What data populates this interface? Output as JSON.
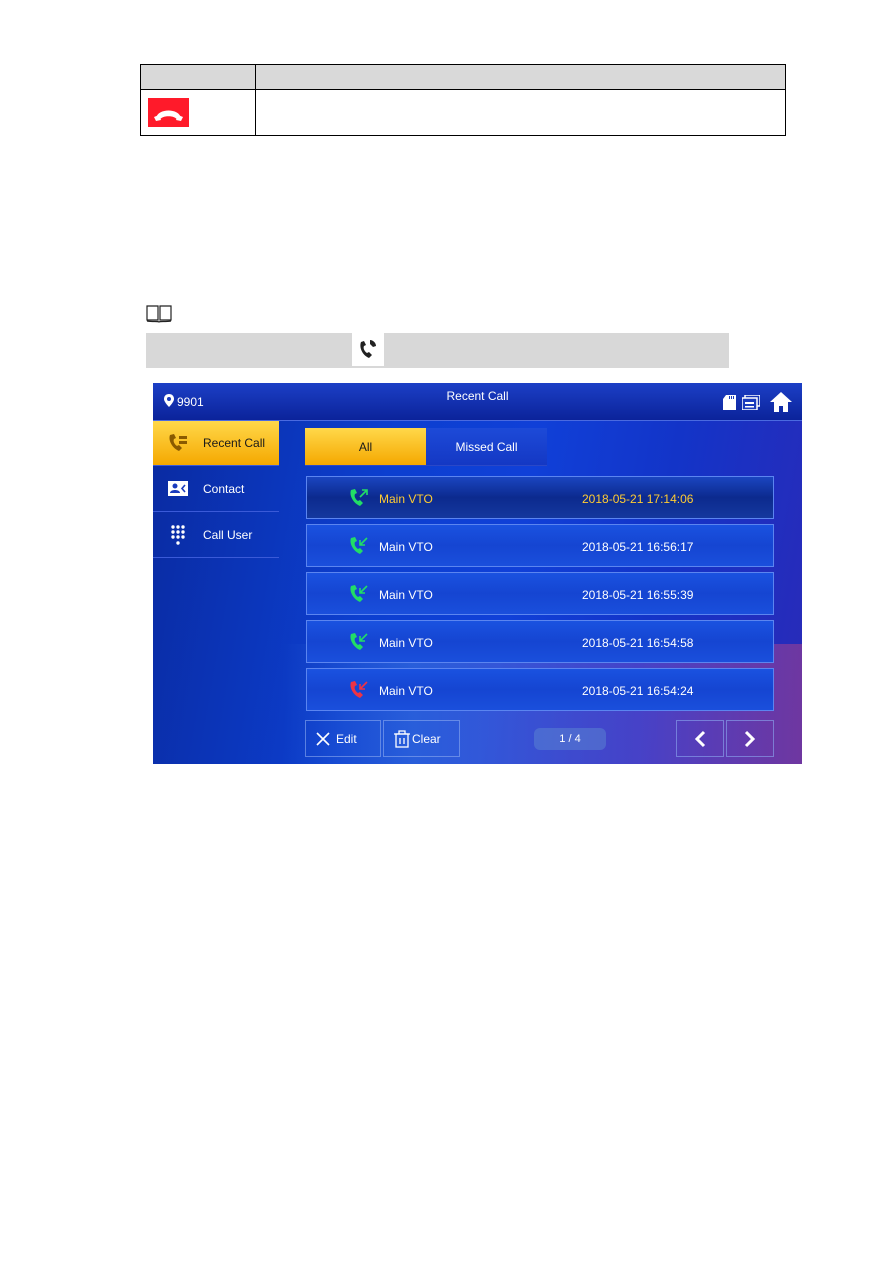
{
  "document": {
    "icon_table": {
      "header_cells": [
        "",
        ""
      ],
      "rows": [
        {
          "icon": "hang-up-icon",
          "icon_color": "#ff1a2a",
          "description": ""
        }
      ]
    },
    "note": {
      "icon": "book-icon",
      "inline_icon": "call-icon"
    }
  },
  "screen": {
    "topbar": {
      "location_icon": "location-pin-icon",
      "room_number": "9901",
      "title": "Recent Call",
      "icons": [
        "sd-card-icon",
        "message-icon",
        "home-icon"
      ]
    },
    "sidebar": {
      "items": [
        {
          "label": "Recent Call",
          "icon": "recent-call-icon",
          "active": true
        },
        {
          "label": "Contact",
          "icon": "contact-icon",
          "active": false
        },
        {
          "label": "Call User",
          "icon": "keypad-icon",
          "active": false
        }
      ]
    },
    "tabs": [
      {
        "label": "All",
        "active": true
      },
      {
        "label": "Missed Call",
        "active": false
      }
    ],
    "calls": [
      {
        "type": "outgoing",
        "icon_color": "#22dd66",
        "name": "Main VTO",
        "time": "2018-05-21 17:14:06",
        "selected": true
      },
      {
        "type": "incoming",
        "icon_color": "#22dd66",
        "name": "Main VTO",
        "time": "2018-05-21 16:56:17",
        "selected": false
      },
      {
        "type": "incoming",
        "icon_color": "#22dd66",
        "name": "Main VTO",
        "time": "2018-05-21 16:55:39",
        "selected": false
      },
      {
        "type": "incoming",
        "icon_color": "#22dd66",
        "name": "Main VTO",
        "time": "2018-05-21 16:54:58",
        "selected": false
      },
      {
        "type": "missed",
        "icon_color": "#ee3344",
        "name": "Main VTO",
        "time": "2018-05-21 16:54:24",
        "selected": false
      }
    ],
    "footer": {
      "edit_label": "Edit",
      "clear_label": "Clear",
      "page_indicator": "1 / 4"
    },
    "colors": {
      "accent": "#f5b400",
      "selected_text": "#ffcc33",
      "background": "#1040d8"
    }
  }
}
